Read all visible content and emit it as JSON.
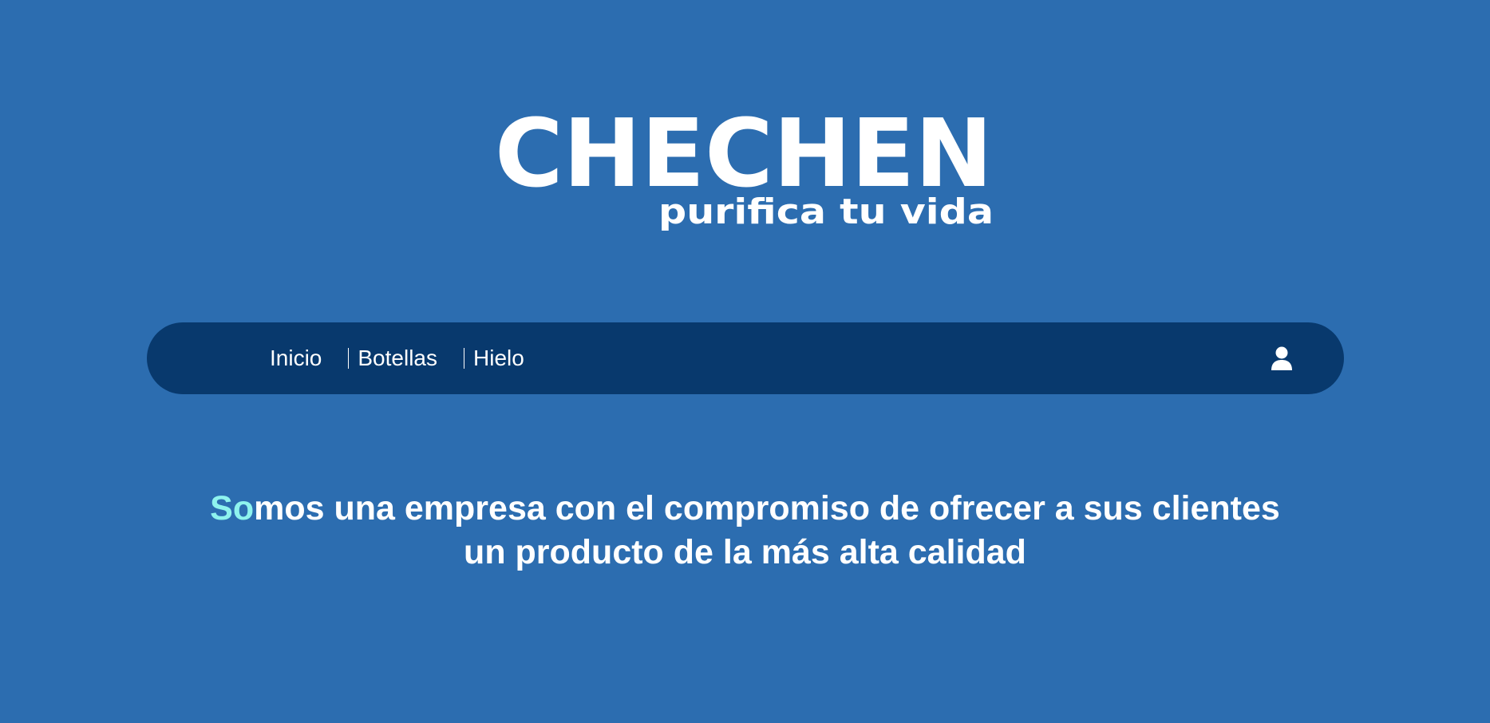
{
  "brand": {
    "name": "CHECHEN",
    "tagline": "purifica tu vida"
  },
  "nav": {
    "items": [
      {
        "label": "Inicio"
      },
      {
        "label": "Botellas"
      },
      {
        "label": "Hielo"
      }
    ],
    "user_icon": "user-icon"
  },
  "hero": {
    "accent_text": "So",
    "line1_rest": "mos una empresa con el compromiso de ofrecer a sus clientes",
    "line2": "un producto de la más alta calidad"
  },
  "colors": {
    "background": "#2c6db0",
    "navbar": "#08396d",
    "accent": "#8ef3ee",
    "text": "#ffffff"
  }
}
